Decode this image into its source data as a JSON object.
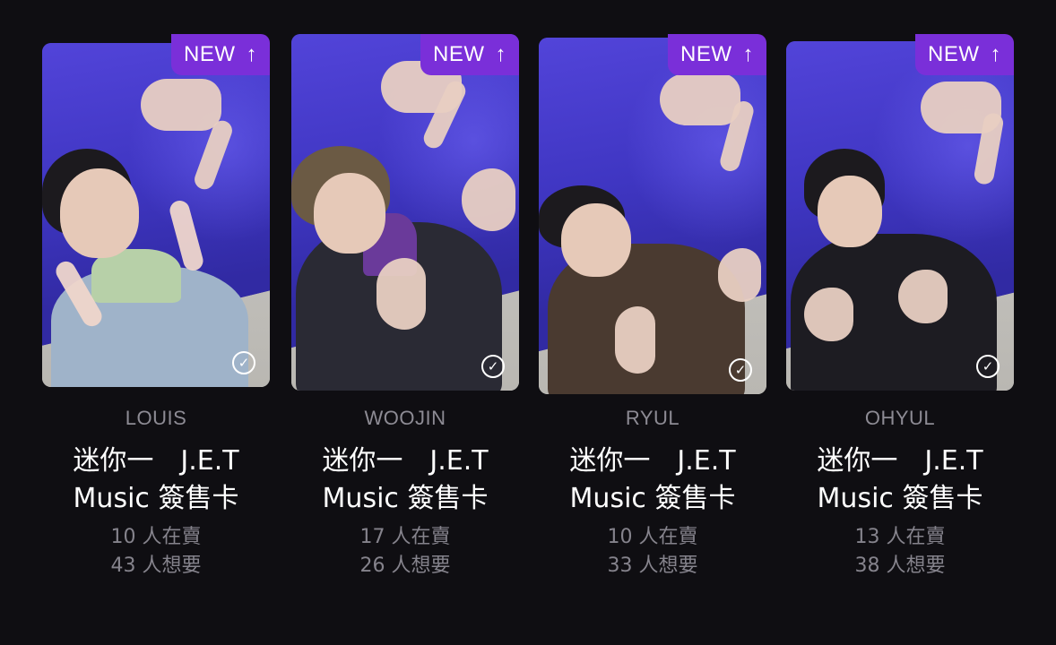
{
  "badge": {
    "label": "NEW",
    "arrow": "↑"
  },
  "check_icon": "✓",
  "cards": [
    {
      "name": "LOUIS",
      "title_line1_a": "迷你一",
      "title_line1_b": "J.E.T",
      "title_line2": "Music 簽售卡",
      "selling": "10 人在賣",
      "wanting": "43 人想要"
    },
    {
      "name": "WOOJIN",
      "title_line1_a": "迷你一",
      "title_line1_b": "J.E.T",
      "title_line2": "Music 簽售卡",
      "selling": "17 人在賣",
      "wanting": "26 人想要"
    },
    {
      "name": "RYUL",
      "title_line1_a": "迷你一",
      "title_line1_b": "J.E.T",
      "title_line2": "Music 簽售卡",
      "selling": "10 人在賣",
      "wanting": "33 人想要"
    },
    {
      "name": "OHYUL",
      "title_line1_a": "迷你一",
      "title_line1_b": "J.E.T",
      "title_line2": "Music 簽售卡",
      "selling": "13 人在賣",
      "wanting": "38 人想要"
    }
  ]
}
